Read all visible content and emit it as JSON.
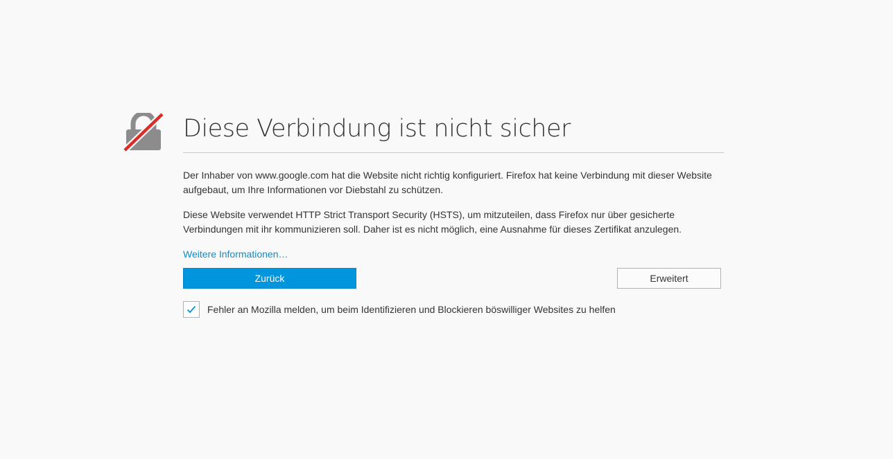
{
  "error_page": {
    "title": "Diese Verbindung ist nicht sicher",
    "paragraph_1": "Der Inhaber von www.google.com hat die Website nicht richtig konfiguriert. Firefox hat keine Verbindung mit dieser Website aufgebaut, um Ihre Informationen vor Diebstahl zu schützen.",
    "paragraph_2": "Diese Website verwendet HTTP Strict Transport Security (HSTS), um mitzuteilen, dass Firefox nur über gesicherte Verbindungen mit ihr kommunizieren soll. Daher ist es nicht möglich, eine Ausnahme für dieses Zertifikat anzulegen.",
    "learn_more_label": "Weitere Informationen…",
    "back_button_label": "Zurück",
    "advanced_button_label": "Erweitert",
    "report_checkbox_checked": true,
    "report_label": "Fehler an Mozilla melden, um beim Identifizieren und Blockieren böswilliger Websites zu helfen"
  },
  "icons": {
    "main_icon": "broken-lock-icon",
    "checkbox_mark": "checkmark-icon"
  },
  "colors": {
    "background": "#f9f9fa",
    "primary_button": "#0095dd",
    "link": "#0a8dcc",
    "lock_gray": "#8c8c8c",
    "strike_red": "#d92d2a"
  }
}
